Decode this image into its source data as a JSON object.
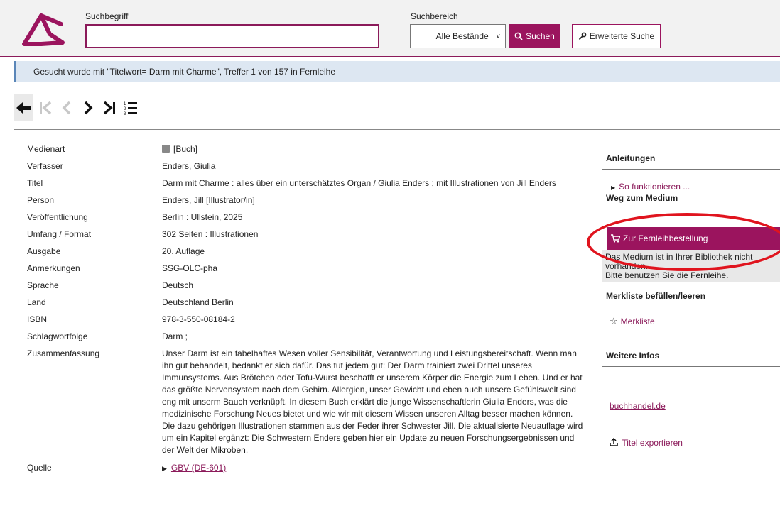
{
  "header": {
    "search_label": "Suchbegriff",
    "search_value": "",
    "scope_label": "Suchbereich",
    "scope_selected": "Alle Bestände",
    "search_button": "Suchen",
    "advanced_button": "Erweiterte Suche"
  },
  "infobar": {
    "text": "Gesucht wurde mit \"Titelwort= Darm mit Charme\", Treffer 1 von 157 in Fernleihe"
  },
  "record": {
    "fields": [
      {
        "key": "Medienart",
        "value": "[Buch]"
      },
      {
        "key": "Verfasser",
        "value": "Enders, Giulia"
      },
      {
        "key": "Titel",
        "value": "Darm mit Charme : alles über ein unterschätztes Organ / Giulia Enders ; mit Illustrationen von Jill Enders"
      },
      {
        "key": "Person",
        "value": "Enders, Jill [Illustrator/in]"
      },
      {
        "key": "Veröffentlichung",
        "value": "Berlin : Ullstein, 2025"
      },
      {
        "key": "Umfang / Format",
        "value": "302 Seiten : Illustrationen"
      },
      {
        "key": "Ausgabe",
        "value": "20. Auflage"
      },
      {
        "key": "Anmerkungen",
        "value": "SSG-OLC-pha"
      },
      {
        "key": "Sprache",
        "value": "Deutsch"
      },
      {
        "key": "Land",
        "value": "Deutschland Berlin"
      },
      {
        "key": "ISBN",
        "value": "978-3-550-08184-2"
      },
      {
        "key": "Schlagwortfolge",
        "value": "Darm ;"
      },
      {
        "key": "Zusammenfassung",
        "value": "Unser Darm ist ein fabelhaftes Wesen voller Sensibilität, Verantwortung und Leistungsbereitschaft. Wenn man ihn gut behandelt, bedankt er sich dafür. Das tut jedem gut: Der Darm trainiert zwei Drittel unseres Immunsystems. Aus Brötchen oder Tofu-Wurst beschafft er unserem Körper die Energie zum Leben. Und er hat das größte Nervensystem nach dem Gehirn. Allergien, unser Gewicht und eben auch unsere Gefühlswelt sind eng mit unserm Bauch verknüpft. In diesem Buch erklärt die junge Wissenschaftlerin Giulia Enders, was die medizinische Forschung Neues bietet und wie wir mit diesem Wissen unseren Alltag besser machen können. Die dazu gehörigen Illustrationen stammen aus der Feder ihrer Schwester Jill. Die aktualisierte Neuauflage wird um ein Kapitel ergänzt: Die Schwestern Enders geben hier ein Update zu neuen Forschungsergebnissen und der Welt der Mikroben."
      },
      {
        "key": "Quelle",
        "value": "GBV (DE-601)"
      }
    ]
  },
  "sidebar": {
    "instructions_title": "Anleitungen",
    "instructions_link": "So funktionieren ...",
    "route_title": "Weg zum Medium",
    "order_button": "Zur Fernleihbestellung",
    "order_note_line1": "Das Medium ist in Ihrer Bibliothek nicht vorhanden.",
    "order_note_line2": "Bitte benutzen Sie die Fernleihe.",
    "watchlist_title": "Merkliste befüllen/leeren",
    "watchlist_link": "Merkliste",
    "more_title": "Weitere Infos",
    "bookshop_link": "buchhandel.de",
    "export_link": "Titel exportieren"
  },
  "colors": {
    "brand": "#9b145e",
    "info_bg": "#dde7f2",
    "annotation": "#e0141e"
  }
}
